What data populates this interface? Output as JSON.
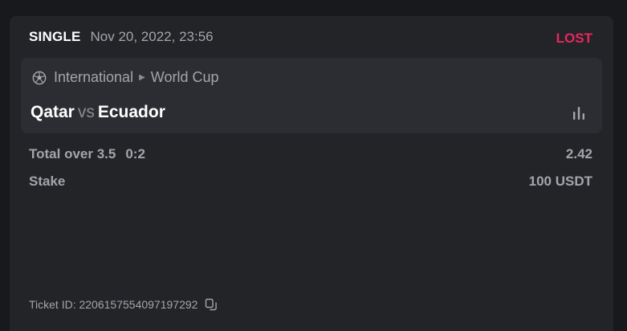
{
  "bet": {
    "type": "SINGLE",
    "date": "Nov 20, 2022, 23:56",
    "status": "LOST",
    "status_color": "#e8265e"
  },
  "event": {
    "icon": "soccer-ball-icon",
    "category": "International",
    "tournament": "World Cup",
    "home_team": "Qatar",
    "vs": "vs",
    "away_team": "Ecuador",
    "stats_icon": "bar-chart-icon"
  },
  "selection": {
    "market": "Total over 3.5",
    "score": "0:2",
    "odds": "2.42"
  },
  "stake": {
    "label": "Stake",
    "value": "100 USDT"
  },
  "ticket": {
    "label": "Ticket ID: 2206157554097197292",
    "copy_icon": "copy-icon"
  }
}
